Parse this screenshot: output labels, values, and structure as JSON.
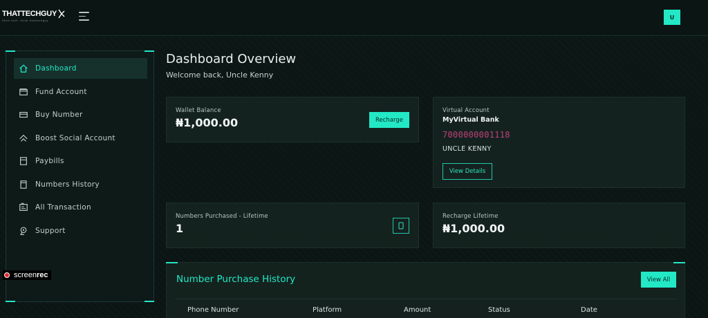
{
  "brand": {
    "name": "THATTECHGUY",
    "tagline": "think tech. think thattechguy"
  },
  "topbar": {
    "avatar_initial": "U"
  },
  "sidebar": {
    "items": [
      {
        "label": "Dashboard",
        "icon": "home-icon",
        "active": true
      },
      {
        "label": "Fund Account",
        "icon": "wallet-icon",
        "active": false
      },
      {
        "label": "Buy Number",
        "icon": "card-icon",
        "active": false
      },
      {
        "label": "Boost Social Account",
        "icon": "chevron-up-double-icon",
        "active": false
      },
      {
        "label": "Paybills",
        "icon": "receipt-icon",
        "active": false
      },
      {
        "label": "Numbers History",
        "icon": "document-icon",
        "active": false
      },
      {
        "label": "All Transaction",
        "icon": "id-card-icon",
        "active": false
      },
      {
        "label": "Support",
        "icon": "support-icon",
        "active": false
      }
    ]
  },
  "screenrec": {
    "label": "screen",
    "label_bold": "rec"
  },
  "main": {
    "title": "Dashboard Overview",
    "welcome": "Welcome back, Uncle Kenny"
  },
  "wallet": {
    "label": "Wallet Balance",
    "value": "₦1,000.00",
    "button": "Recharge"
  },
  "virtual_account": {
    "label": "Virtual Account",
    "bank": "MyVirtual Bank",
    "account_number": "7000000001118",
    "account_name": "UNCLE KENNY",
    "button": "View Details"
  },
  "numbers_purchased": {
    "label": "Numbers Purchased - Lifetime",
    "value": "1"
  },
  "recharge_lifetime": {
    "label": "Recharge Lifetime",
    "value": "₦1,000.00"
  },
  "history": {
    "title": "Number Purchase History",
    "button": "View All",
    "columns": [
      "Phone Number",
      "Platform",
      "Amount",
      "Status",
      "Date"
    ]
  },
  "colors": {
    "accent": "#22e8c6",
    "background": "#0b1614",
    "account_number": "#c2407a"
  }
}
